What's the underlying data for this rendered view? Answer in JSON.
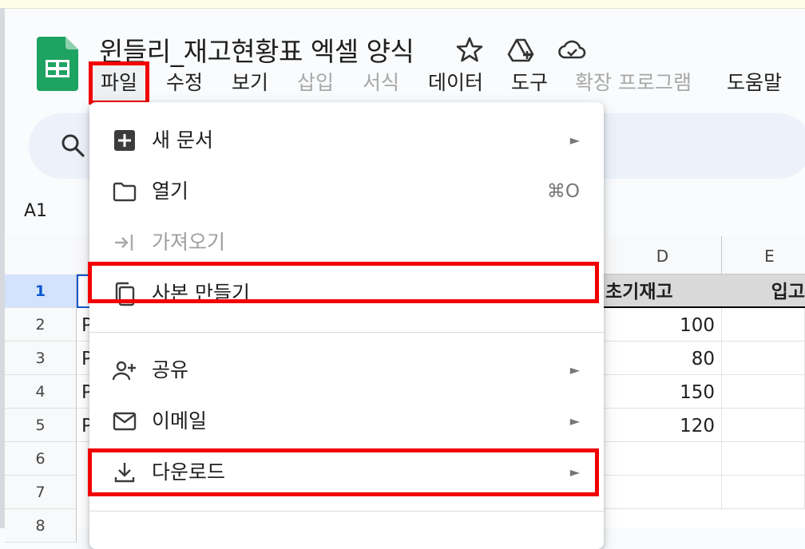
{
  "doc": {
    "title": "윈들리_재고현황표 엑셀 양식"
  },
  "menubar": [
    {
      "label": "파일",
      "disabled": false,
      "highlighted": true
    },
    {
      "label": "수정",
      "disabled": false
    },
    {
      "label": "보기",
      "disabled": false
    },
    {
      "label": "삽입",
      "disabled": true
    },
    {
      "label": "서식",
      "disabled": true
    },
    {
      "label": "데이터",
      "disabled": false
    },
    {
      "label": "도구",
      "disabled": false
    },
    {
      "label": "확장 프로그램",
      "disabled": true
    },
    {
      "label": "도움말",
      "disabled": false
    }
  ],
  "namebox": "A1",
  "columns": [
    "D",
    "E"
  ],
  "header_row": {
    "d": "초기재고",
    "e": "입고"
  },
  "rows": [
    {
      "num": "1"
    },
    {
      "num": "2",
      "a": "P",
      "d": "100"
    },
    {
      "num": "3",
      "a": "P",
      "d": "80"
    },
    {
      "num": "4",
      "a": "P",
      "d": "150"
    },
    {
      "num": "5",
      "a": "P",
      "d": "120"
    },
    {
      "num": "6"
    },
    {
      "num": "7"
    },
    {
      "num": "8"
    }
  ],
  "file_menu": {
    "new": {
      "label": "새 문서",
      "icon": "new-doc-icon",
      "has_submenu": true
    },
    "open": {
      "label": "열기",
      "icon": "folder-icon",
      "shortcut": "⌘O"
    },
    "import": {
      "label": "가져오기",
      "icon": "import-icon",
      "disabled": true
    },
    "copy": {
      "label": "사본 만들기",
      "icon": "copy-icon",
      "highlighted": true
    },
    "share": {
      "label": "공유",
      "icon": "share-person-icon",
      "has_submenu": true
    },
    "email": {
      "label": "이메일",
      "icon": "email-icon",
      "has_submenu": true
    },
    "download": {
      "label": "다운로드",
      "icon": "download-icon",
      "has_submenu": true,
      "highlighted": true
    },
    "submenu_arrow": "►"
  },
  "colors": {
    "highlight": "#f20000",
    "sheets_green": "#1ea362",
    "selected_row": "#d3e3fd"
  }
}
